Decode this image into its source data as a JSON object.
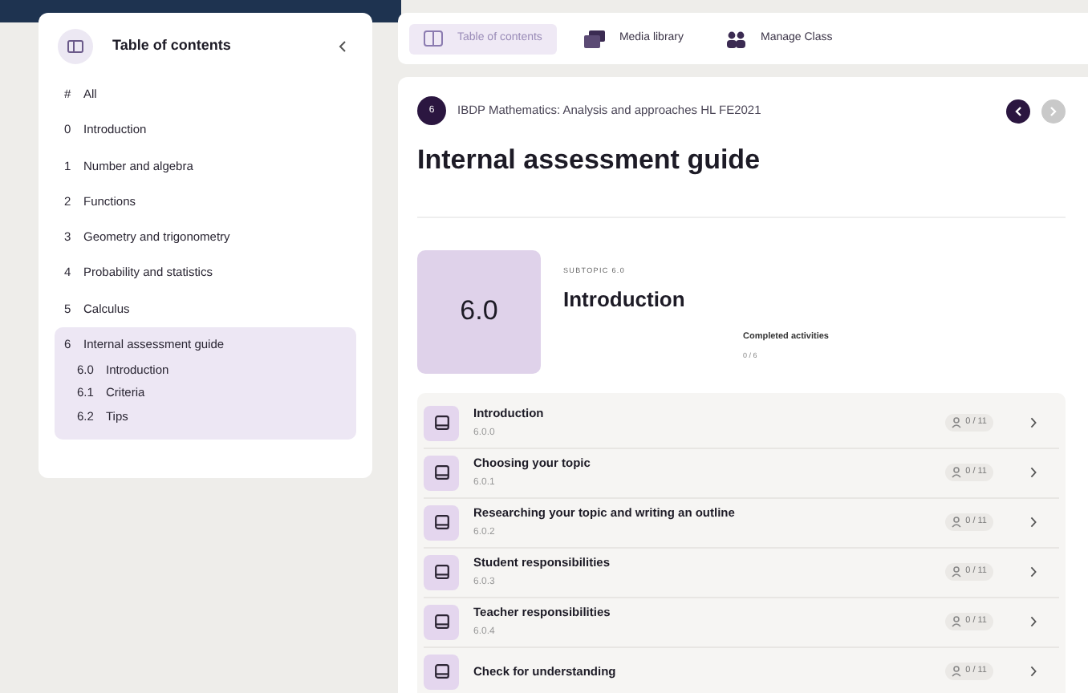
{
  "sidebar": {
    "title": "Table of contents",
    "items": [
      {
        "number": "#",
        "label": "All",
        "selected": false
      },
      {
        "number": "0",
        "label": "Introduction",
        "selected": false
      },
      {
        "number": "1",
        "label": "Number and algebra",
        "selected": false
      },
      {
        "number": "2",
        "label": "Functions",
        "selected": false
      },
      {
        "number": "3",
        "label": "Geometry and trigonometry",
        "selected": false
      },
      {
        "number": "4",
        "label": "Probability and statistics",
        "selected": false
      },
      {
        "number": "5",
        "label": "Calculus",
        "selected": false
      },
      {
        "number": "6",
        "label": "Internal assessment guide",
        "selected": true,
        "children": [
          {
            "number": "6.0",
            "label": "Introduction"
          },
          {
            "number": "6.1",
            "label": "Criteria"
          },
          {
            "number": "6.2",
            "label": "Tips"
          }
        ]
      }
    ]
  },
  "tabs": [
    {
      "label": "Table of contents",
      "kind": "toc",
      "selected": true
    },
    {
      "label": "Media library",
      "kind": "media",
      "selected": false
    },
    {
      "label": "Manage Class",
      "kind": "class",
      "selected": false
    }
  ],
  "header": {
    "badge": "6",
    "course": "IBDP Mathematics: Analysis and approaches HL FE2021",
    "title": "Internal assessment guide",
    "prev_disabled": false,
    "next_disabled": true
  },
  "subtopic": {
    "number": "6.0",
    "eyebrow": "SUBTOPIC 6.0",
    "title": "Introduction",
    "progress_label": "Completed activities",
    "progress_value": "0 / 6"
  },
  "activities": [
    {
      "title": "Introduction",
      "code": "6.0.0",
      "count": "0 / 11"
    },
    {
      "title": "Choosing your topic",
      "code": "6.0.1",
      "count": "0 / 11"
    },
    {
      "title": "Researching your topic and writing an outline",
      "code": "6.0.2",
      "count": "0 / 11"
    },
    {
      "title": "Student responsibilities",
      "code": "6.0.3",
      "count": "0 / 11"
    },
    {
      "title": "Teacher responsibilities",
      "code": "6.0.4",
      "count": "0 / 11"
    },
    {
      "title": "Check for understanding",
      "count": "0 / 11"
    }
  ]
}
